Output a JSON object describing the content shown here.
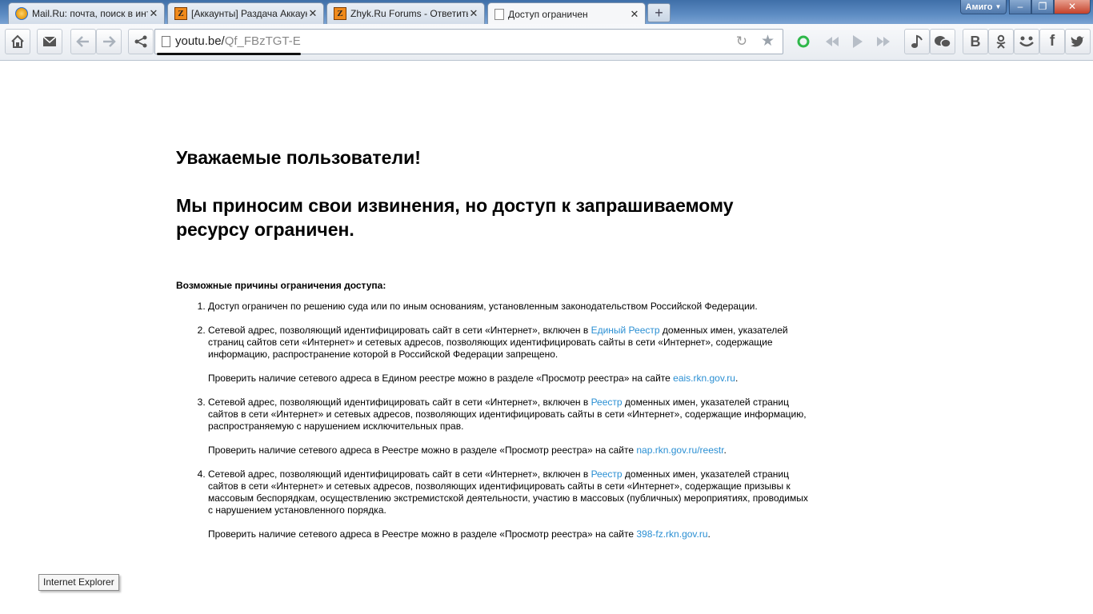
{
  "window": {
    "tabs": [
      {
        "title": "Mail.Ru: почта, поиск в инт",
        "icon": "mailru-icon"
      },
      {
        "title": "[Аккаунты] Раздача Аккаун",
        "icon": "zhyk-icon"
      },
      {
        "title": "Zhyk.Ru Forums - Ответить",
        "icon": "zhyk-icon"
      },
      {
        "title": "Доступ ограничен",
        "icon": "page-icon"
      }
    ],
    "close_glyph": "✕",
    "new_tab_glyph": "+",
    "profile_label": "Амиго",
    "controls": {
      "minimize": "–",
      "maximize": "❐",
      "close": "✕"
    }
  },
  "toolbar": {
    "url_host": "youtu.be/",
    "url_path": "Qf_FBzTGT-E",
    "reload_glyph": "↻",
    "star_glyph": "★",
    "icons": [
      "home-icon",
      "mail-icon",
      "back-icon",
      "forward-icon",
      "share-icon",
      "amigo-icon",
      "prev-track-icon",
      "play-icon",
      "next-track-icon",
      "music-icon",
      "chat-icon",
      "vk-icon",
      "odnoklassniki-icon",
      "moimir-icon",
      "facebook-icon",
      "twitter-icon"
    ]
  },
  "page": {
    "greeting": "Уважаемые пользователи!",
    "apology": "Мы приносим свои извинения, но доступ к запрашиваемому ресурсу ограничен.",
    "reasons_title": "Возможные причины ограничения доступа:",
    "reason1": "Доступ ограничен  по решению суда или по иным основаниям, установленным законодательством Российской Федерации.",
    "reason2_a": "Сетевой адрес, позволяющий идентифицировать сайт в сети «Интернет», включен в ",
    "reason2_link": "Единый Реестр",
    "reason2_b": " доменных имен, указателей страниц сайтов сети «Интернет» и сетевых адресов, позволяющих идентифицировать сайты в сети «Интернет», содержащие информацию, распространение которой в Российской Федерации запрещено.",
    "reason2_check": "Проверить наличие сетевого адреса в Едином реестре можно в разделе «Просмотр реестра» на сайте ",
    "reason2_site": "eais.rkn.gov.ru",
    "reason3_a": "Сетевой адрес, позволяющий идентифицировать сайт в сети «Интернет», включен в ",
    "reason3_link": "Реестр",
    "reason3_b": " доменных имен, указателей страниц сайтов в сети «Интернет» и сетевых адресов, позволяющих идентифицировать сайты в сети «Интернет», содержащие информацию, распространяемую с нарушением исключительных прав.",
    "reason3_check": "Проверить наличие сетевого адреса в Реестре можно в разделе «Просмотр реестра» на сайте ",
    "reason3_site": "nap.rkn.gov.ru/reestr",
    "reason4_a": "Сетевой адрес, позволяющий идентифицировать сайт в сети «Интернет», включен в ",
    "reason4_link": "Реестр",
    "reason4_b": " доменных имен, указателей страниц сайтов в сети «Интернет» и сетевых адресов, позволяющих идентифицировать сайты в сети «Интернет», содержащие призывы к массовым беспорядкам, осуществлению экстремистской деятельности, участию в массовых (публичных) мероприятиях, проводимых с нарушением установленного порядка.",
    "reason4_check": "Проверить наличие сетевого адреса в Реестре можно в разделе «Просмотр реестра» на сайте ",
    "reason4_site": "398-fz.rkn.gov.ru",
    "period": "."
  },
  "overlay": {
    "ie_label": "Internet Explorer"
  },
  "colors": {
    "link": "#2a8fd3",
    "titlebar": "#5d8cc3"
  }
}
